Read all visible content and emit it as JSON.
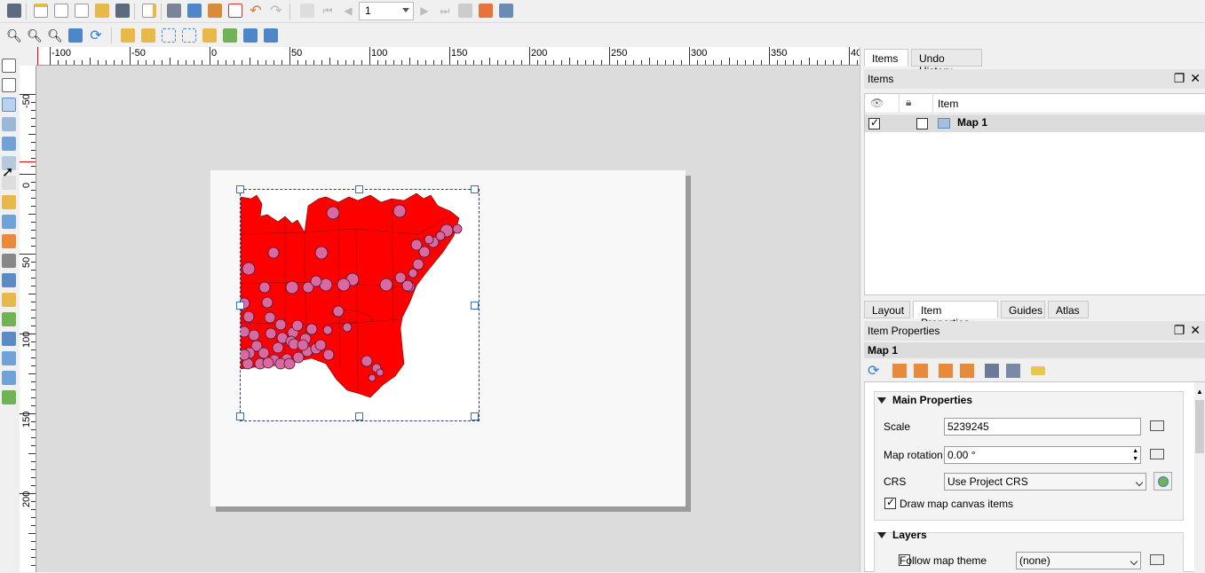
{
  "toolbar": {
    "page_number": "1"
  },
  "rulers": {
    "horizontal_labels": [
      "-100",
      "-50",
      "0",
      "50",
      "100",
      "150",
      "200",
      "250",
      "300",
      "350",
      "40"
    ],
    "vertical_labels": [
      "-50",
      "0",
      "50",
      "100",
      "150",
      "200"
    ]
  },
  "panel": {
    "top_tabs": [
      "Items",
      "Undo History"
    ],
    "items_dock_title": "Items",
    "items_header": "Item",
    "items": [
      {
        "name": "Map 1",
        "visible": true,
        "locked": false
      }
    ],
    "bottom_tabs": [
      "Layout",
      "Item Properties",
      "Guides",
      "Atlas"
    ],
    "item_props_dock_title": "Item Properties",
    "item_name": "Map 1",
    "main_properties": {
      "title": "Main Properties",
      "scale_label": "Scale",
      "scale_value": "5239245",
      "rotation_label": "Map rotation",
      "rotation_value": "0.00 °",
      "crs_label": "CRS",
      "crs_value": "Use Project CRS",
      "draw_items_label": "Draw map canvas items",
      "draw_items_checked": true
    },
    "layers": {
      "title": "Layers",
      "follow_theme_label": "Follow map theme",
      "theme_value": "(none)",
      "follow_theme_checked": false
    }
  },
  "colors": {
    "map_fill": "#ff0000",
    "marker_fill": "#d96aa0",
    "accent": "#3a6fbf"
  }
}
